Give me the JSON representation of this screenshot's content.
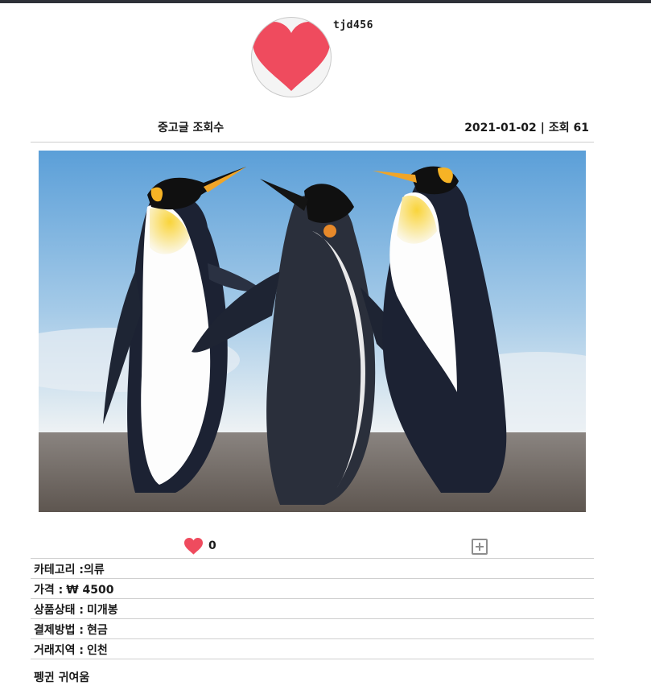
{
  "user": {
    "username": "tjd456"
  },
  "post": {
    "title": "중고글 조회수",
    "date": "2021-01-02",
    "separator": "|",
    "views_text": "조회 61",
    "image_alt": "penguins",
    "description": "펭귄 귀여움"
  },
  "actions": {
    "like_count": "0"
  },
  "details": {
    "category_label": "카테고리 :",
    "category_value": "의류",
    "price_label": "가격 :",
    "price_value": "₩ 4500",
    "condition_label": "상품상태 :",
    "condition_value": "미개봉",
    "payment_label": "결제방법 :",
    "payment_value": "현금",
    "region_label": "거래지역 :",
    "region_value": "인천"
  },
  "colors": {
    "heart": "#ef4b5e",
    "top_bar": "#2e3138",
    "divider": "#cfcfcf"
  },
  "icons": {
    "avatar": "heart-icon",
    "like": "heart-icon",
    "add": "plus-square-icon"
  }
}
